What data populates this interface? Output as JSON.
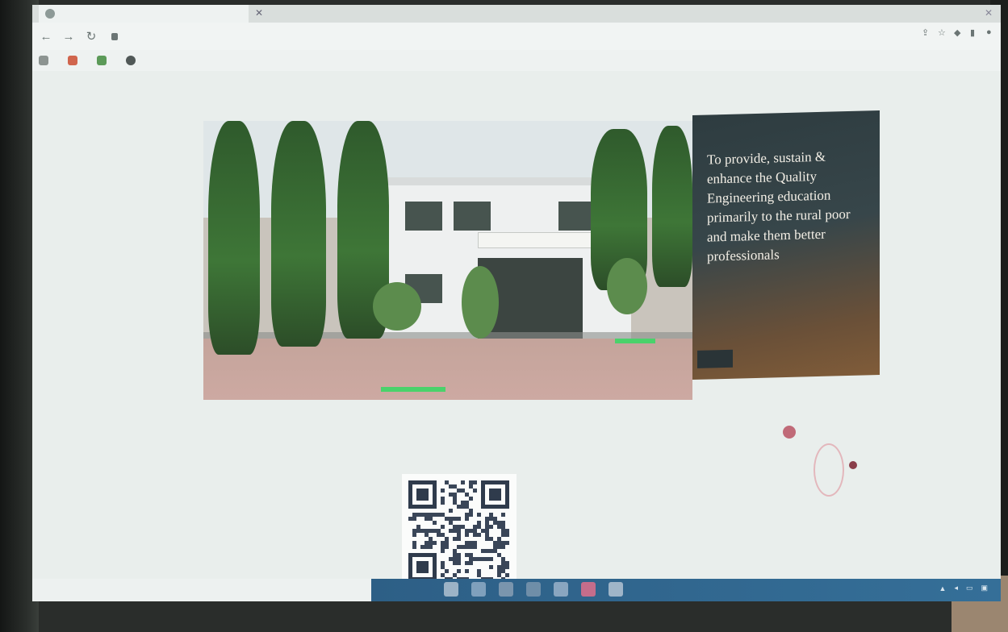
{
  "browser": {
    "tab_title": "",
    "address_text": "",
    "bookmarks": [
      {
        "label": "",
        "icon": "bookmark-icon",
        "color": "#8c9491"
      },
      {
        "label": "",
        "icon": "mail-icon",
        "color": "#d0654d"
      },
      {
        "label": "",
        "icon": "maps-icon",
        "color": "#5b9a58"
      },
      {
        "label": "",
        "icon": "globe-icon",
        "color": "#505857"
      }
    ]
  },
  "page": {
    "mission_text": "To provide, sustain & enhance the Quality Engineering education primarily to the rural poor and make them better professionals",
    "caption_lines": [
      "",
      ""
    ],
    "aside_title": "",
    "aside_note": ""
  },
  "colors": {
    "accent_green": "#4ad26b",
    "taskbar": "#2d5f86"
  }
}
